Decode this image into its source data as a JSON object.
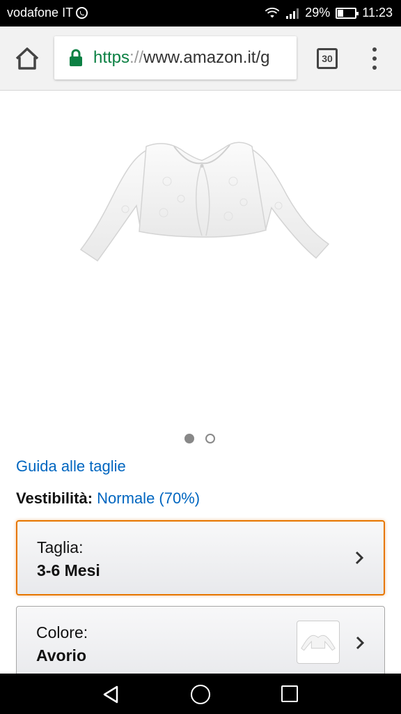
{
  "status_bar": {
    "carrier": "vodafone IT",
    "battery": "29%",
    "time": "11:23"
  },
  "browser": {
    "url_scheme": "https",
    "url_separator": "://",
    "url_rest": "www.amazon.it/g",
    "tab_count": "30"
  },
  "carousel": {
    "total": 2,
    "active_index": 0
  },
  "product": {
    "size_guide_link": "Guida alle taglie",
    "fit_label": "Vestibilità:",
    "fit_value": "Normale (70%)",
    "size_selector": {
      "label": "Taglia:",
      "value": "3-6 Mesi"
    },
    "color_selector": {
      "label": "Colore:",
      "value": "Avorio"
    }
  },
  "colors": {
    "link": "#0066c0",
    "focus_border": "#e77600",
    "secure_green": "#0b8043"
  }
}
